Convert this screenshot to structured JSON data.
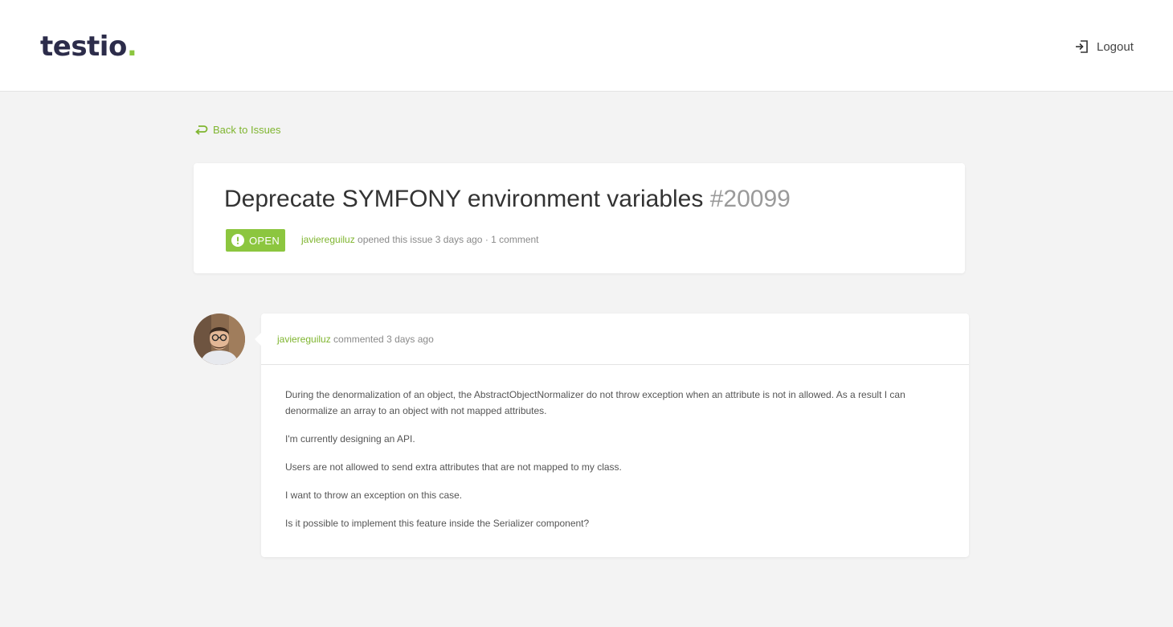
{
  "header": {
    "logo_text": "testio",
    "logo_dot": ".",
    "logout_label": "Logout",
    "logout_icon": "logout-icon"
  },
  "back_link": {
    "label": "Back to Issues",
    "icon": "back-arrow-icon"
  },
  "issue": {
    "title": "Deprecate SYMFONY environment variables",
    "number": "#20099",
    "status": "OPEN",
    "status_icon": "alert-circle-icon",
    "author": "javiereguiluz",
    "opened_text": " opened this issue 3 days ago",
    "separator": " · ",
    "comments_count": "1 comment"
  },
  "comment": {
    "author": "javiereguiluz",
    "action_text": " commented 3 days ago",
    "avatar_icon": "user-avatar",
    "paragraphs": [
      "During the denormalization of an object, the AbstractObjectNormalizer do not throw exception when an attribute is not in allowed. As a result I can denormalize an array to an object with not mapped attributes.",
      "I'm currently designing an API.",
      "Users are not allowed to send extra attributes that are not mapped to my class.",
      "I want to throw an exception on this case.",
      "Is it possible to implement this feature inside the Serializer component?"
    ]
  },
  "colors": {
    "accent": "#8cc63f",
    "link": "#7fb52f",
    "logo": "#2c2c4a",
    "background": "#f3f3f3"
  }
}
